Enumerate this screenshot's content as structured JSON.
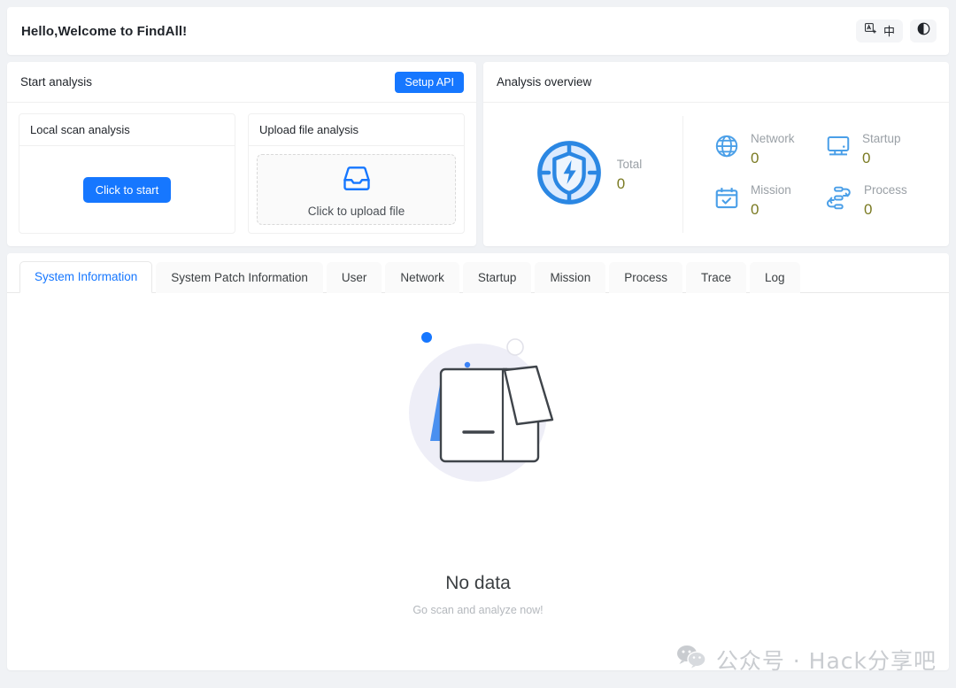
{
  "header": {
    "greeting": "Hello,Welcome to FindAll!",
    "lang_label": "中",
    "lang_icon": "translate-icon",
    "theme_icon": "half-moon-icon"
  },
  "start_analysis": {
    "title": "Start analysis",
    "setup_api_label": "Setup API",
    "local_scan": {
      "title": "Local scan analysis",
      "button_label": "Click to start"
    },
    "upload": {
      "title": "Upload file analysis",
      "dropzone_label": "Click to upload file",
      "dropzone_icon": "inbox-tray-icon"
    }
  },
  "overview": {
    "title": "Analysis overview",
    "total": {
      "label": "Total",
      "value": "0",
      "icon": "shield-bolt-target-icon"
    },
    "stats": [
      {
        "label": "Network",
        "value": "0",
        "icon": "globe-icon"
      },
      {
        "label": "Startup",
        "value": "0",
        "icon": "monitor-icon"
      },
      {
        "label": "Mission",
        "value": "0",
        "icon": "calendar-check-icon"
      },
      {
        "label": "Process",
        "value": "0",
        "icon": "process-flow-icon"
      }
    ]
  },
  "tabs": {
    "active_index": 0,
    "items": [
      {
        "label": "System Information"
      },
      {
        "label": "System Patch Information"
      },
      {
        "label": "User"
      },
      {
        "label": "Network"
      },
      {
        "label": "Startup"
      },
      {
        "label": "Mission"
      },
      {
        "label": "Process"
      },
      {
        "label": "Trace"
      },
      {
        "label": "Log"
      }
    ]
  },
  "empty_state": {
    "illustration": "open-box-icon",
    "title": "No data",
    "subtitle": "Go scan and analyze now!"
  },
  "watermark": {
    "icon": "wechat-icon",
    "text": "公众号 · Hack分享吧"
  },
  "colors": {
    "accent": "#1677ff",
    "value_olive": "#7a7a22",
    "muted": "#9aa0a6",
    "page_bg": "#f0f2f5"
  }
}
